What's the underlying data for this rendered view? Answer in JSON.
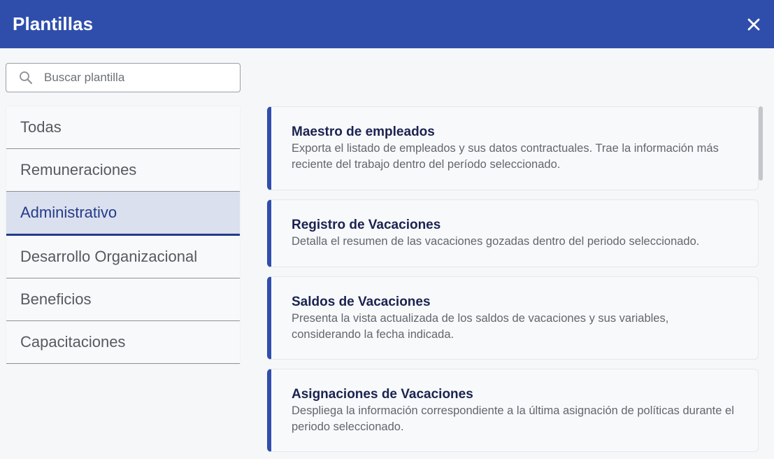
{
  "header": {
    "title": "Plantillas",
    "close_icon": "close-icon"
  },
  "search": {
    "placeholder": "Buscar plantilla",
    "value": "",
    "icon": "search-icon"
  },
  "categories": [
    {
      "label": "Todas",
      "active": false
    },
    {
      "label": "Remuneraciones",
      "active": false
    },
    {
      "label": "Administrativo",
      "active": true
    },
    {
      "label": "Desarrollo Organizacional",
      "active": false
    },
    {
      "label": "Beneficios",
      "active": false
    },
    {
      "label": "Capacitaciones",
      "active": false
    }
  ],
  "templates": [
    {
      "title": "Maestro de empleados",
      "description": "Exporta el listado de empleados y sus datos contractuales. Trae la información más reciente del trabajo dentro del período seleccionado."
    },
    {
      "title": "Registro de Vacaciones",
      "description": "Detalla el resumen de las vacaciones gozadas dentro del periodo seleccionado."
    },
    {
      "title": "Saldos de Vacaciones",
      "description": "Presenta la vista actualizada de los saldos de vacaciones y sus variables, considerando la fecha indicada."
    },
    {
      "title": "Asignaciones de Vacaciones",
      "description": "Despliega la información correspondiente a la última asignación de políticas durante el periodo seleccionado."
    }
  ],
  "colors": {
    "header_bg": "#2f4eac",
    "accent": "#233b8a",
    "active_bg": "#dbe0ee"
  }
}
